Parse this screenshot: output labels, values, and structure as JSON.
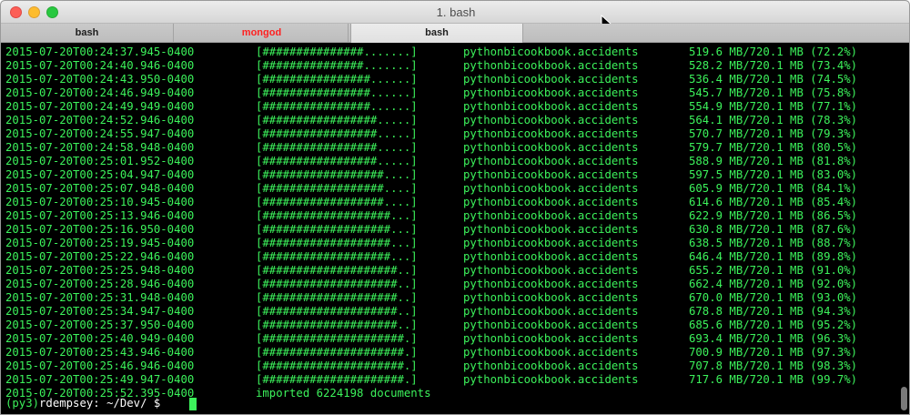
{
  "window": {
    "title": "1. bash"
  },
  "tabs": [
    {
      "label": "bash",
      "active": false,
      "color": "#1e1e1e"
    },
    {
      "label": "mongod",
      "active": false,
      "color": "#ff2020"
    },
    {
      "label": "bash",
      "active": true,
      "color": "#1e1e1e"
    }
  ],
  "terminal": {
    "text_color": "#3cf25b",
    "background": "#000000",
    "lines": [
      {
        "timestamp": "2015-07-20T00:24:37.945-0400",
        "bar": "[###############.......]",
        "collection": "pythonbicookbook.accidents",
        "size": "519.6 MB/720.1 MB (72.2%)"
      },
      {
        "timestamp": "2015-07-20T00:24:40.946-0400",
        "bar": "[###############.......]",
        "collection": "pythonbicookbook.accidents",
        "size": "528.2 MB/720.1 MB (73.4%)"
      },
      {
        "timestamp": "2015-07-20T00:24:43.950-0400",
        "bar": "[################......]",
        "collection": "pythonbicookbook.accidents",
        "size": "536.4 MB/720.1 MB (74.5%)"
      },
      {
        "timestamp": "2015-07-20T00:24:46.949-0400",
        "bar": "[################......]",
        "collection": "pythonbicookbook.accidents",
        "size": "545.7 MB/720.1 MB (75.8%)"
      },
      {
        "timestamp": "2015-07-20T00:24:49.949-0400",
        "bar": "[################......]",
        "collection": "pythonbicookbook.accidents",
        "size": "554.9 MB/720.1 MB (77.1%)"
      },
      {
        "timestamp": "2015-07-20T00:24:52.946-0400",
        "bar": "[#################.....]",
        "collection": "pythonbicookbook.accidents",
        "size": "564.1 MB/720.1 MB (78.3%)"
      },
      {
        "timestamp": "2015-07-20T00:24:55.947-0400",
        "bar": "[#################.....]",
        "collection": "pythonbicookbook.accidents",
        "size": "570.7 MB/720.1 MB (79.3%)"
      },
      {
        "timestamp": "2015-07-20T00:24:58.948-0400",
        "bar": "[#################.....]",
        "collection": "pythonbicookbook.accidents",
        "size": "579.7 MB/720.1 MB (80.5%)"
      },
      {
        "timestamp": "2015-07-20T00:25:01.952-0400",
        "bar": "[#################.....]",
        "collection": "pythonbicookbook.accidents",
        "size": "588.9 MB/720.1 MB (81.8%)"
      },
      {
        "timestamp": "2015-07-20T00:25:04.947-0400",
        "bar": "[##################....]",
        "collection": "pythonbicookbook.accidents",
        "size": "597.5 MB/720.1 MB (83.0%)"
      },
      {
        "timestamp": "2015-07-20T00:25:07.948-0400",
        "bar": "[##################....]",
        "collection": "pythonbicookbook.accidents",
        "size": "605.9 MB/720.1 MB (84.1%)"
      },
      {
        "timestamp": "2015-07-20T00:25:10.945-0400",
        "bar": "[##################....]",
        "collection": "pythonbicookbook.accidents",
        "size": "614.6 MB/720.1 MB (85.4%)"
      },
      {
        "timestamp": "2015-07-20T00:25:13.946-0400",
        "bar": "[###################...]",
        "collection": "pythonbicookbook.accidents",
        "size": "622.9 MB/720.1 MB (86.5%)"
      },
      {
        "timestamp": "2015-07-20T00:25:16.950-0400",
        "bar": "[###################...]",
        "collection": "pythonbicookbook.accidents",
        "size": "630.8 MB/720.1 MB (87.6%)"
      },
      {
        "timestamp": "2015-07-20T00:25:19.945-0400",
        "bar": "[###################...]",
        "collection": "pythonbicookbook.accidents",
        "size": "638.5 MB/720.1 MB (88.7%)"
      },
      {
        "timestamp": "2015-07-20T00:25:22.946-0400",
        "bar": "[###################...]",
        "collection": "pythonbicookbook.accidents",
        "size": "646.4 MB/720.1 MB (89.8%)"
      },
      {
        "timestamp": "2015-07-20T00:25:25.948-0400",
        "bar": "[####################..]",
        "collection": "pythonbicookbook.accidents",
        "size": "655.2 MB/720.1 MB (91.0%)"
      },
      {
        "timestamp": "2015-07-20T00:25:28.946-0400",
        "bar": "[####################..]",
        "collection": "pythonbicookbook.accidents",
        "size": "662.4 MB/720.1 MB (92.0%)"
      },
      {
        "timestamp": "2015-07-20T00:25:31.948-0400",
        "bar": "[####################..]",
        "collection": "pythonbicookbook.accidents",
        "size": "670.0 MB/720.1 MB (93.0%)"
      },
      {
        "timestamp": "2015-07-20T00:25:34.947-0400",
        "bar": "[####################..]",
        "collection": "pythonbicookbook.accidents",
        "size": "678.8 MB/720.1 MB (94.3%)"
      },
      {
        "timestamp": "2015-07-20T00:25:37.950-0400",
        "bar": "[####################..]",
        "collection": "pythonbicookbook.accidents",
        "size": "685.6 MB/720.1 MB (95.2%)"
      },
      {
        "timestamp": "2015-07-20T00:25:40.949-0400",
        "bar": "[#####################.]",
        "collection": "pythonbicookbook.accidents",
        "size": "693.4 MB/720.1 MB (96.3%)"
      },
      {
        "timestamp": "2015-07-20T00:25:43.946-0400",
        "bar": "[#####################.]",
        "collection": "pythonbicookbook.accidents",
        "size": "700.9 MB/720.1 MB (97.3%)"
      },
      {
        "timestamp": "2015-07-20T00:25:46.946-0400",
        "bar": "[#####################.]",
        "collection": "pythonbicookbook.accidents",
        "size": "707.8 MB/720.1 MB (98.3%)"
      },
      {
        "timestamp": "2015-07-20T00:25:49.947-0400",
        "bar": "[#####################.]",
        "collection": "pythonbicookbook.accidents",
        "size": "717.6 MB/720.1 MB (99.7%)"
      }
    ],
    "final": {
      "timestamp": "2015-07-20T00:25:52.395-0400",
      "message": "imported 6224198 documents"
    },
    "prompt": {
      "env": "(py3)",
      "text": "rdempsey: ~/Dev/ $ "
    }
  }
}
